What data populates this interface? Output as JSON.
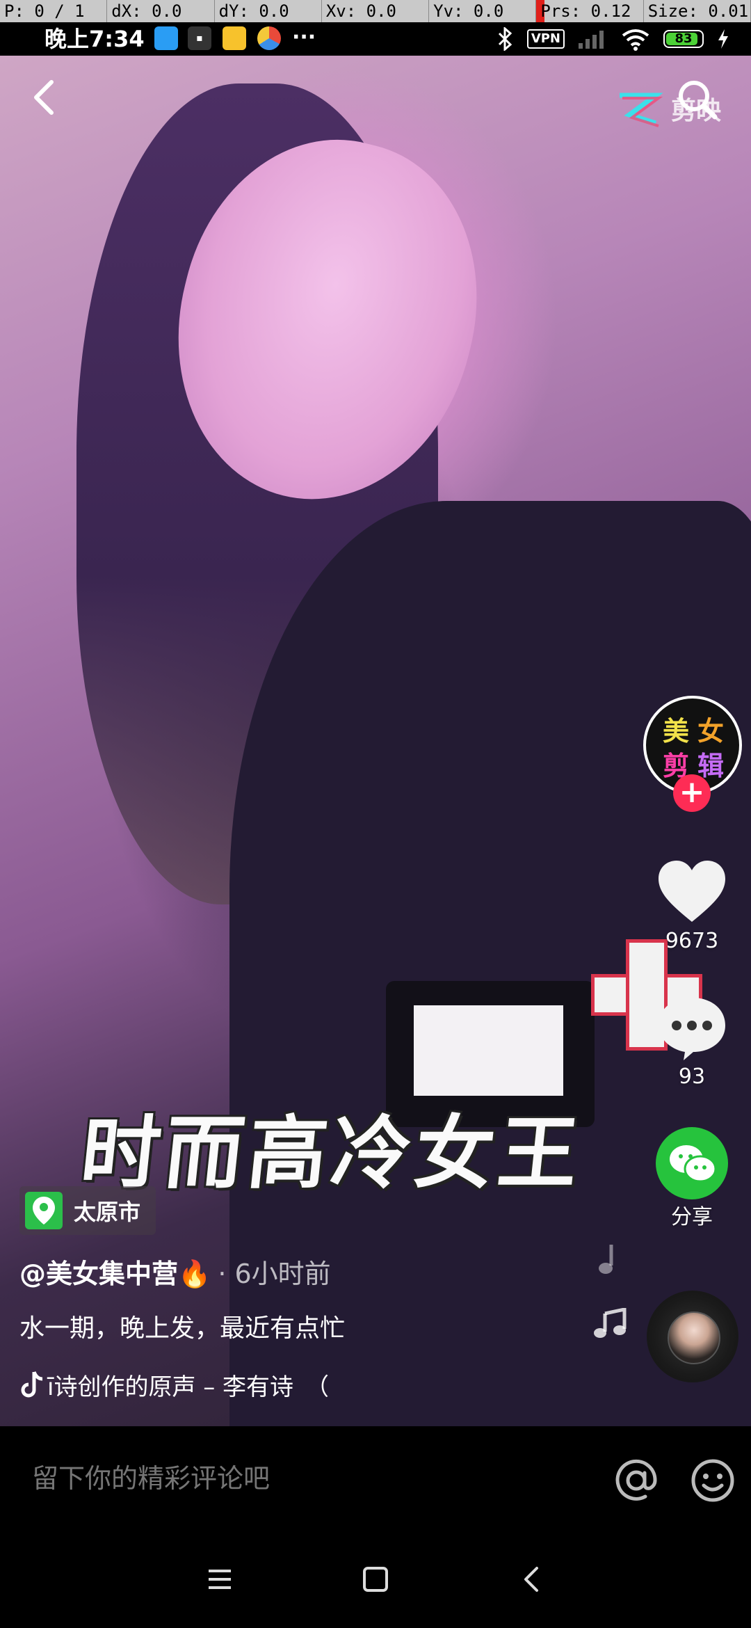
{
  "debug_overlay": {
    "pointer": "P: 0 / 1",
    "dx": "dX: 0.0",
    "dy": "dY: 0.0",
    "xv": "Xv: 0.0",
    "yv": "Yv: 0.0",
    "prs": "Prs: 0.12",
    "size": "Size: 0.01"
  },
  "status_bar": {
    "time": "晚上7:34",
    "app_icons": [
      "qq-icon",
      "app-icon",
      "weibo-icon",
      "browser-icon"
    ],
    "more": "···",
    "vpn": "VPN",
    "battery": "83"
  },
  "top_bar": {
    "capcut_label": "剪映"
  },
  "video": {
    "caption_overlay": "时而高冷女王",
    "location": "太原市",
    "author": "@美女集中营🔥",
    "time_ago": "· 6小时前",
    "description": "水一期，晚上发，最近有点忙",
    "music": "ī诗创作的原声 – 李有诗　（"
  },
  "creator_avatar": {
    "chars": [
      "美",
      "女",
      "剪",
      "辑"
    ],
    "follow": "+"
  },
  "actions": {
    "likes": "9673",
    "comments": "93",
    "share": "分享"
  },
  "comment_bar": {
    "placeholder": "留下你的精彩评论吧",
    "mention": "@"
  },
  "colors": {
    "like": "#ffffff",
    "follow": "#fe2c55",
    "share": "#26c33d",
    "location_pin": "#2bbf4a"
  }
}
